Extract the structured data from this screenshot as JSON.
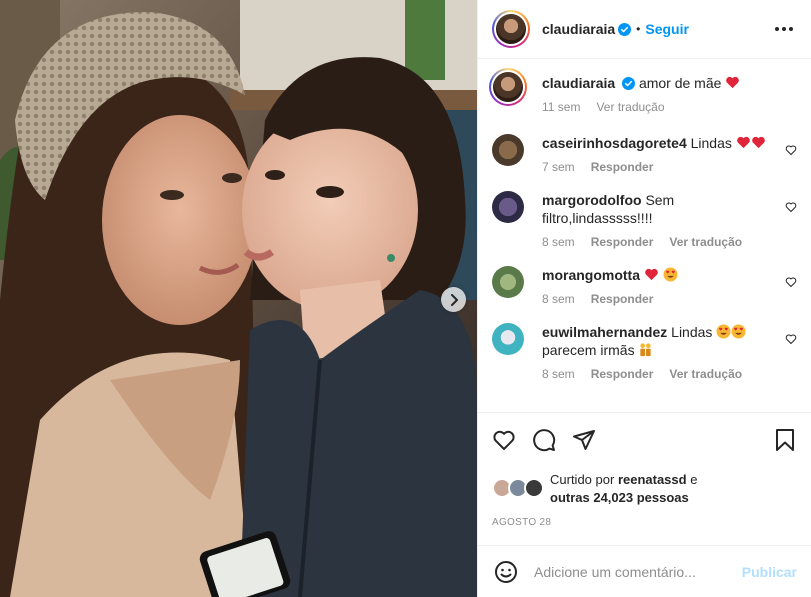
{
  "post": {
    "author": "claudiaraia",
    "follow_label": "Seguir",
    "separator": "•"
  },
  "caption": {
    "username": "claudiaraia",
    "text": "amor de mãe",
    "time": "11 sem",
    "translate_label": "Ver tradução"
  },
  "comments": [
    {
      "username": "caseirinhosdagorete4",
      "text": "Lindas",
      "time": "7 sem",
      "reply_label": "Responder",
      "translate_label": "",
      "avatar_color": "#4a3a2c"
    },
    {
      "username": "margorodolfoo",
      "text": "Sem filtro,lindasssss!!!!",
      "time": "8 sem",
      "reply_label": "Responder",
      "translate_label": "Ver tradução",
      "avatar_color": "#2d2a45"
    },
    {
      "username": "morangomotta",
      "text": "",
      "time": "8 sem",
      "reply_label": "Responder",
      "translate_label": "",
      "avatar_color": "#5a7a4a"
    },
    {
      "username": "euwilmahernandez",
      "text": "Lindas",
      "text2": "parecem irmãs",
      "time": "8 sem",
      "reply_label": "Responder",
      "translate_label": "Ver tradução",
      "avatar_color": "#3fb3c0"
    }
  ],
  "likes": {
    "prefix": "Curtido por",
    "user": "reenatassd",
    "joiner": "e",
    "others": "outras 24,023 pessoas"
  },
  "date": "AGOSTO 28",
  "add_comment": {
    "placeholder": "Adicione um comentário...",
    "post_label": "Publicar"
  },
  "icons": [
    "heart-icon",
    "comment-icon",
    "share-icon",
    "bookmark-icon",
    "emoji-icon",
    "more-icon",
    "chevron-right-icon",
    "verified-icon"
  ],
  "colors": {
    "accent": "#0095f6",
    "heart": "#ed4956",
    "muted": "#8e8e8e",
    "post_disabled": "#b2dffc"
  }
}
